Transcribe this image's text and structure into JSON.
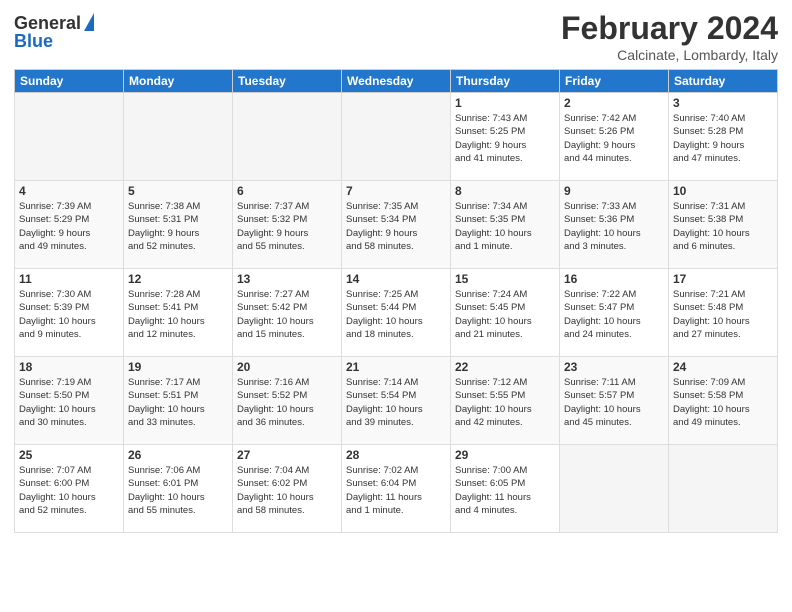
{
  "header": {
    "logo_general": "General",
    "logo_blue": "Blue",
    "month_title": "February 2024",
    "location": "Calcinate, Lombardy, Italy"
  },
  "days_of_week": [
    "Sunday",
    "Monday",
    "Tuesday",
    "Wednesday",
    "Thursday",
    "Friday",
    "Saturday"
  ],
  "weeks": [
    {
      "days": [
        {
          "num": "",
          "info": ""
        },
        {
          "num": "",
          "info": ""
        },
        {
          "num": "",
          "info": ""
        },
        {
          "num": "",
          "info": ""
        },
        {
          "num": "1",
          "info": "Sunrise: 7:43 AM\nSunset: 5:25 PM\nDaylight: 9 hours\nand 41 minutes."
        },
        {
          "num": "2",
          "info": "Sunrise: 7:42 AM\nSunset: 5:26 PM\nDaylight: 9 hours\nand 44 minutes."
        },
        {
          "num": "3",
          "info": "Sunrise: 7:40 AM\nSunset: 5:28 PM\nDaylight: 9 hours\nand 47 minutes."
        }
      ]
    },
    {
      "days": [
        {
          "num": "4",
          "info": "Sunrise: 7:39 AM\nSunset: 5:29 PM\nDaylight: 9 hours\nand 49 minutes."
        },
        {
          "num": "5",
          "info": "Sunrise: 7:38 AM\nSunset: 5:31 PM\nDaylight: 9 hours\nand 52 minutes."
        },
        {
          "num": "6",
          "info": "Sunrise: 7:37 AM\nSunset: 5:32 PM\nDaylight: 9 hours\nand 55 minutes."
        },
        {
          "num": "7",
          "info": "Sunrise: 7:35 AM\nSunset: 5:34 PM\nDaylight: 9 hours\nand 58 minutes."
        },
        {
          "num": "8",
          "info": "Sunrise: 7:34 AM\nSunset: 5:35 PM\nDaylight: 10 hours\nand 1 minute."
        },
        {
          "num": "9",
          "info": "Sunrise: 7:33 AM\nSunset: 5:36 PM\nDaylight: 10 hours\nand 3 minutes."
        },
        {
          "num": "10",
          "info": "Sunrise: 7:31 AM\nSunset: 5:38 PM\nDaylight: 10 hours\nand 6 minutes."
        }
      ]
    },
    {
      "days": [
        {
          "num": "11",
          "info": "Sunrise: 7:30 AM\nSunset: 5:39 PM\nDaylight: 10 hours\nand 9 minutes."
        },
        {
          "num": "12",
          "info": "Sunrise: 7:28 AM\nSunset: 5:41 PM\nDaylight: 10 hours\nand 12 minutes."
        },
        {
          "num": "13",
          "info": "Sunrise: 7:27 AM\nSunset: 5:42 PM\nDaylight: 10 hours\nand 15 minutes."
        },
        {
          "num": "14",
          "info": "Sunrise: 7:25 AM\nSunset: 5:44 PM\nDaylight: 10 hours\nand 18 minutes."
        },
        {
          "num": "15",
          "info": "Sunrise: 7:24 AM\nSunset: 5:45 PM\nDaylight: 10 hours\nand 21 minutes."
        },
        {
          "num": "16",
          "info": "Sunrise: 7:22 AM\nSunset: 5:47 PM\nDaylight: 10 hours\nand 24 minutes."
        },
        {
          "num": "17",
          "info": "Sunrise: 7:21 AM\nSunset: 5:48 PM\nDaylight: 10 hours\nand 27 minutes."
        }
      ]
    },
    {
      "days": [
        {
          "num": "18",
          "info": "Sunrise: 7:19 AM\nSunset: 5:50 PM\nDaylight: 10 hours\nand 30 minutes."
        },
        {
          "num": "19",
          "info": "Sunrise: 7:17 AM\nSunset: 5:51 PM\nDaylight: 10 hours\nand 33 minutes."
        },
        {
          "num": "20",
          "info": "Sunrise: 7:16 AM\nSunset: 5:52 PM\nDaylight: 10 hours\nand 36 minutes."
        },
        {
          "num": "21",
          "info": "Sunrise: 7:14 AM\nSunset: 5:54 PM\nDaylight: 10 hours\nand 39 minutes."
        },
        {
          "num": "22",
          "info": "Sunrise: 7:12 AM\nSunset: 5:55 PM\nDaylight: 10 hours\nand 42 minutes."
        },
        {
          "num": "23",
          "info": "Sunrise: 7:11 AM\nSunset: 5:57 PM\nDaylight: 10 hours\nand 45 minutes."
        },
        {
          "num": "24",
          "info": "Sunrise: 7:09 AM\nSunset: 5:58 PM\nDaylight: 10 hours\nand 49 minutes."
        }
      ]
    },
    {
      "days": [
        {
          "num": "25",
          "info": "Sunrise: 7:07 AM\nSunset: 6:00 PM\nDaylight: 10 hours\nand 52 minutes."
        },
        {
          "num": "26",
          "info": "Sunrise: 7:06 AM\nSunset: 6:01 PM\nDaylight: 10 hours\nand 55 minutes."
        },
        {
          "num": "27",
          "info": "Sunrise: 7:04 AM\nSunset: 6:02 PM\nDaylight: 10 hours\nand 58 minutes."
        },
        {
          "num": "28",
          "info": "Sunrise: 7:02 AM\nSunset: 6:04 PM\nDaylight: 11 hours\nand 1 minute."
        },
        {
          "num": "29",
          "info": "Sunrise: 7:00 AM\nSunset: 6:05 PM\nDaylight: 11 hours\nand 4 minutes."
        },
        {
          "num": "",
          "info": ""
        },
        {
          "num": "",
          "info": ""
        }
      ]
    }
  ]
}
